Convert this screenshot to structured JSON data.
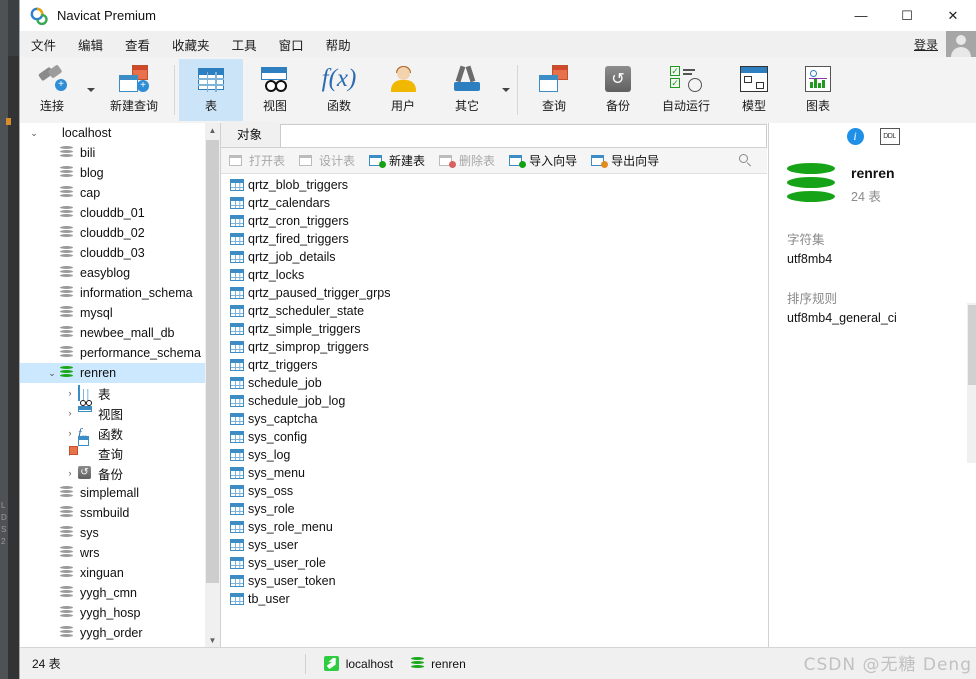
{
  "window": {
    "title": "Navicat Premium",
    "controls": {
      "minimize": "—",
      "maximize": "☐",
      "close": "✕"
    }
  },
  "menubar": {
    "items": [
      "文件",
      "编辑",
      "查看",
      "收藏夹",
      "工具",
      "窗口",
      "帮助"
    ],
    "login_label": "登录"
  },
  "ribbon": {
    "buttons": [
      {
        "label": "连接",
        "icon": "connection-plus-icon",
        "has_caret": true,
        "active": false
      },
      {
        "label": "新建查询",
        "icon": "new-query-icon",
        "has_caret": false,
        "active": false
      },
      {
        "label": "表",
        "icon": "table-icon",
        "has_caret": false,
        "active": true
      },
      {
        "label": "视图",
        "icon": "view-icon",
        "has_caret": false,
        "active": false
      },
      {
        "label": "函数",
        "icon": "function-fx-icon",
        "has_caret": false,
        "active": false
      },
      {
        "label": "用户",
        "icon": "user-icon",
        "has_caret": false,
        "active": false
      },
      {
        "label": "其它",
        "icon": "other-tools-icon",
        "has_caret": true,
        "active": false
      },
      {
        "label": "查询",
        "icon": "query-icon",
        "has_caret": false,
        "active": false
      },
      {
        "label": "备份",
        "icon": "backup-icon",
        "has_caret": false,
        "active": false
      },
      {
        "label": "自动运行",
        "icon": "automation-icon",
        "has_caret": false,
        "active": false
      },
      {
        "label": "模型",
        "icon": "model-icon",
        "has_caret": false,
        "active": false
      },
      {
        "label": "图表",
        "icon": "chart-icon",
        "has_caret": false,
        "active": false
      }
    ]
  },
  "tree": {
    "nodes": [
      {
        "label": "localhost",
        "icon": "host-icon",
        "indent": 0,
        "twist": "expanded",
        "selected": false
      },
      {
        "label": "bili",
        "icon": "database-icon",
        "indent": 1,
        "twist": "none",
        "selected": false
      },
      {
        "label": "blog",
        "icon": "database-icon",
        "indent": 1,
        "twist": "none",
        "selected": false
      },
      {
        "label": "cap",
        "icon": "database-icon",
        "indent": 1,
        "twist": "none",
        "selected": false
      },
      {
        "label": "clouddb_01",
        "icon": "database-icon",
        "indent": 1,
        "twist": "none",
        "selected": false
      },
      {
        "label": "clouddb_02",
        "icon": "database-icon",
        "indent": 1,
        "twist": "none",
        "selected": false
      },
      {
        "label": "clouddb_03",
        "icon": "database-icon",
        "indent": 1,
        "twist": "none",
        "selected": false
      },
      {
        "label": "easyblog",
        "icon": "database-icon",
        "indent": 1,
        "twist": "none",
        "selected": false
      },
      {
        "label": "information_schema",
        "icon": "database-icon",
        "indent": 1,
        "twist": "none",
        "selected": false
      },
      {
        "label": "mysql",
        "icon": "database-icon",
        "indent": 1,
        "twist": "none",
        "selected": false
      },
      {
        "label": "newbee_mall_db",
        "icon": "database-icon",
        "indent": 1,
        "twist": "none",
        "selected": false
      },
      {
        "label": "performance_schema",
        "icon": "database-icon",
        "indent": 1,
        "twist": "none",
        "selected": false
      },
      {
        "label": "renren",
        "icon": "database-green-icon",
        "indent": 1,
        "twist": "expanded",
        "selected": true
      },
      {
        "label": "表",
        "icon": "table-icon",
        "indent": 2,
        "twist": "collapsed",
        "selected": false
      },
      {
        "label": "视图",
        "icon": "view-icon",
        "indent": 2,
        "twist": "collapsed",
        "selected": false
      },
      {
        "label": "函数",
        "icon": "function-fx-icon",
        "indent": 2,
        "twist": "collapsed",
        "selected": false
      },
      {
        "label": "查询",
        "icon": "query-icon",
        "indent": 2,
        "twist": "collapsed",
        "selected": false
      },
      {
        "label": "备份",
        "icon": "backup-icon",
        "indent": 2,
        "twist": "collapsed",
        "selected": false
      },
      {
        "label": "simplemall",
        "icon": "database-icon",
        "indent": 1,
        "twist": "none",
        "selected": false
      },
      {
        "label": "ssmbuild",
        "icon": "database-icon",
        "indent": 1,
        "twist": "none",
        "selected": false
      },
      {
        "label": "sys",
        "icon": "database-icon",
        "indent": 1,
        "twist": "none",
        "selected": false
      },
      {
        "label": "wrs",
        "icon": "database-icon",
        "indent": 1,
        "twist": "none",
        "selected": false
      },
      {
        "label": "xinguan",
        "icon": "database-icon",
        "indent": 1,
        "twist": "none",
        "selected": false
      },
      {
        "label": "yygh_cmn",
        "icon": "database-icon",
        "indent": 1,
        "twist": "none",
        "selected": false
      },
      {
        "label": "yygh_hosp",
        "icon": "database-icon",
        "indent": 1,
        "twist": "none",
        "selected": false
      },
      {
        "label": "yygh_order",
        "icon": "database-icon",
        "indent": 1,
        "twist": "none",
        "selected": false
      }
    ]
  },
  "objects": {
    "tab_label": "对象",
    "search_placeholder": "",
    "toolbar": [
      {
        "label": "打开表",
        "icon": "open-table-icon",
        "disabled": true
      },
      {
        "label": "设计表",
        "icon": "design-table-icon",
        "disabled": true
      },
      {
        "label": "新建表",
        "icon": "new-table-icon",
        "disabled": false
      },
      {
        "label": "删除表",
        "icon": "delete-table-icon",
        "disabled": true
      },
      {
        "label": "导入向导",
        "icon": "import-wizard-icon",
        "disabled": false
      },
      {
        "label": "导出向导",
        "icon": "export-wizard-icon",
        "disabled": false
      }
    ],
    "tables": [
      "qrtz_blob_triggers",
      "qrtz_calendars",
      "qrtz_cron_triggers",
      "qrtz_fired_triggers",
      "qrtz_job_details",
      "qrtz_locks",
      "qrtz_paused_trigger_grps",
      "qrtz_scheduler_state",
      "qrtz_simple_triggers",
      "qrtz_simprop_triggers",
      "qrtz_triggers",
      "schedule_job",
      "schedule_job_log",
      "sys_captcha",
      "sys_config",
      "sys_log",
      "sys_menu",
      "sys_oss",
      "sys_role",
      "sys_role_menu",
      "sys_user",
      "sys_user_role",
      "sys_user_token",
      "tb_user"
    ]
  },
  "info": {
    "info_icon_label": "i",
    "ddl_icon_label": "DDL",
    "db_name": "renren",
    "db_subtitle": "24 表",
    "charset_label": "字符集",
    "charset_value": "utf8mb4",
    "collation_label": "排序规则",
    "collation_value": "utf8mb4_general_ci"
  },
  "statusbar": {
    "count_text": "24 表",
    "host": "localhost",
    "database": "renren"
  },
  "watermark": {
    "text": "CSDN @无糖 Deng"
  },
  "colors": {
    "accent": "#2d7fc0",
    "selection": "#cce8ff",
    "ribbon_active": "#cce4f7",
    "green_db": "#17a317",
    "gray_db": "#9b9b9b"
  }
}
